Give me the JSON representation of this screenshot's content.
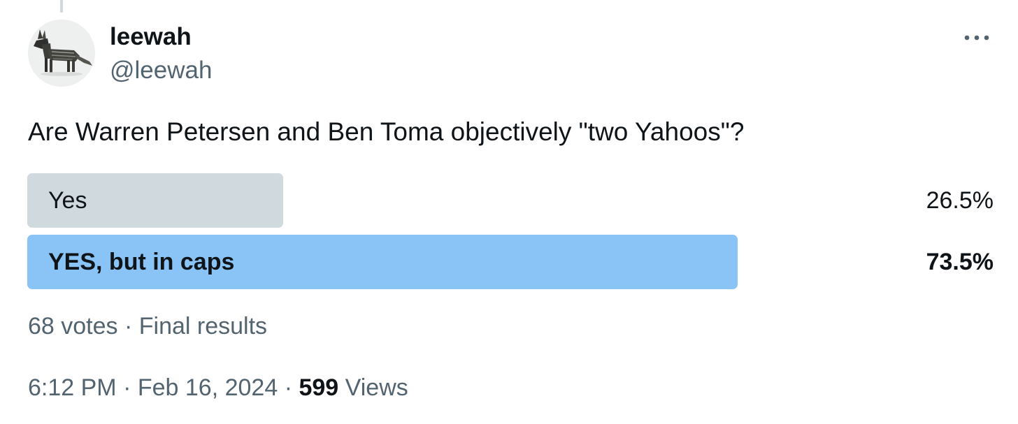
{
  "author": {
    "display_name": "leewah",
    "handle": "@leewah",
    "avatar_icon": "wolf-sculpture-avatar"
  },
  "menu": {
    "icon": "more-horizontal-icon"
  },
  "tweet": {
    "text": "Are Warren Petersen and Ben Toma objectively \"two Yahoos\"?"
  },
  "poll": {
    "options": [
      {
        "label": "Yes",
        "percent_text": "26.5%",
        "percent": 26.5,
        "winner": false,
        "bar_color": "#cfd9de"
      },
      {
        "label": "YES, but in caps",
        "percent_text": "73.5%",
        "percent": 73.5,
        "winner": true,
        "bar_color": "#8ac3f5"
      }
    ],
    "votes": "68 votes",
    "separator": "·",
    "status": "Final results"
  },
  "meta": {
    "time": "6:12 PM",
    "separator": "·",
    "date": "Feb 16, 2024",
    "views_count": "599",
    "views_label": "Views"
  },
  "colors": {
    "text_primary": "#0f1419",
    "text_secondary": "#536471",
    "bar_loser": "#cfd9de",
    "bar_winner": "#8ac3f5"
  }
}
